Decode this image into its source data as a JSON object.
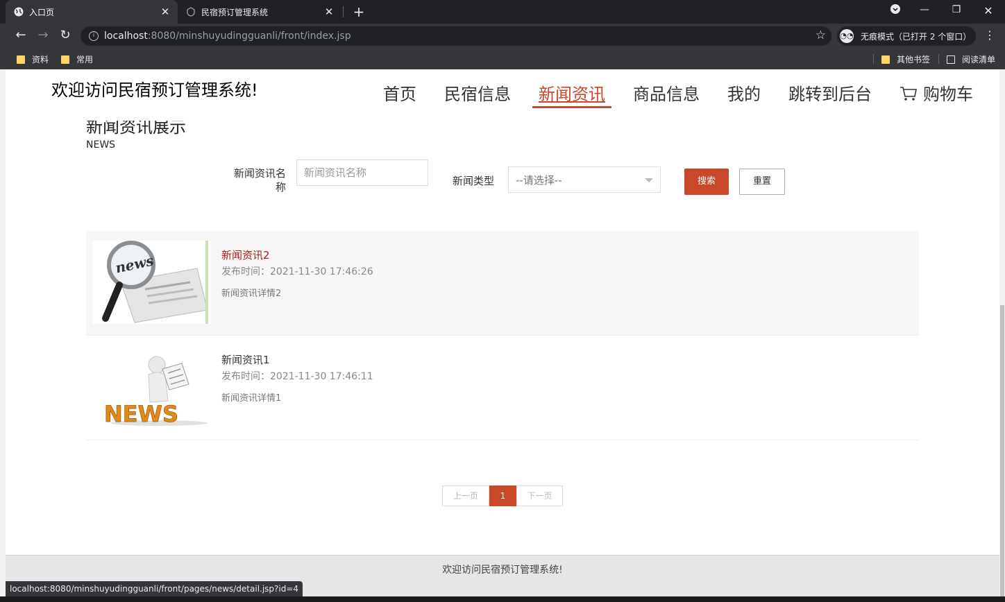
{
  "browser": {
    "tabs": [
      {
        "title": "入口页",
        "active": true
      },
      {
        "title": "民宿预订管理系统",
        "active": false
      }
    ],
    "url_host": "localhost",
    "url_rest": ":8080/minshuyudingguanli/front/index.jsp",
    "incognito_label": "无痕模式（已打开 2 个窗口）",
    "bookmarks": [
      "资料",
      "常用"
    ],
    "bookmarks_right": [
      "其他书签",
      "阅读清单"
    ],
    "status_url": "localhost:8080/minshuyudingguanli/front/pages/news/detail.jsp?id=4"
  },
  "site": {
    "title": "欢迎访问民宿预订管理系统!",
    "nav": [
      "首页",
      "民宿信息",
      "新闻资讯",
      "商品信息",
      "我的",
      "跳转到后台",
      "购物车"
    ],
    "active_nav": "新闻资讯"
  },
  "section": {
    "title": "新闻资讯展示",
    "subtitle": "NEWS"
  },
  "search": {
    "name_label": "新闻资讯名称",
    "name_placeholder": "新闻资讯名称",
    "type_label": "新闻类型",
    "type_selected": "--请选择--",
    "search_button": "搜索",
    "reset_button": "重置"
  },
  "news": [
    {
      "title": "新闻资讯2",
      "time": "发布时间：2021-11-30 17:46:26",
      "desc": "新闻资讯详情2",
      "thumb_text": "news"
    },
    {
      "title": "新闻资讯1",
      "time": "发布时间：2021-11-30 17:46:11",
      "desc": "新闻资讯详情1",
      "thumb_text": "NEWS"
    }
  ],
  "pager": {
    "prev": "上一页",
    "current": "1",
    "next": "下一页"
  },
  "footer": {
    "text": "欢迎访问民宿预订管理系统!"
  },
  "colors": {
    "accent": "#c9482a",
    "title_red": "#a61b1b"
  }
}
